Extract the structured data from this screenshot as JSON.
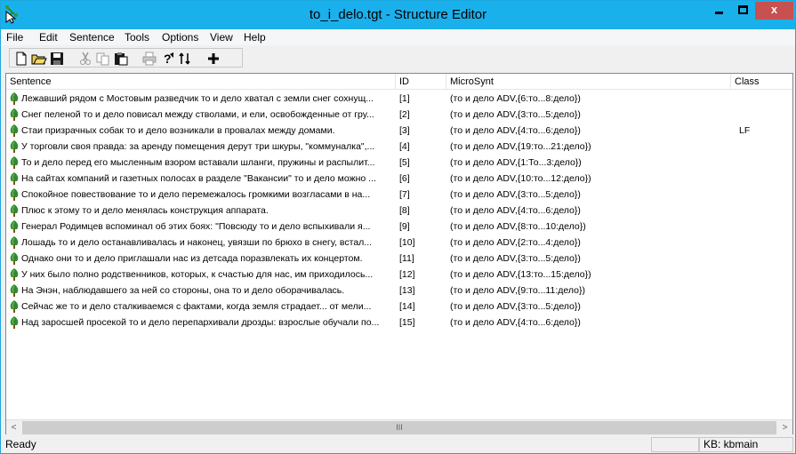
{
  "window": {
    "title": "to_i_delo.tgt - Structure Editor",
    "minimize_glyph": "",
    "close_glyph": "x"
  },
  "menu": [
    "File",
    "Edit",
    "Sentence",
    "Tools",
    "Options",
    "View",
    "Help"
  ],
  "toolbar": {
    "icons": [
      "new-document-icon",
      "open-folder-icon",
      "save-disk-icon",
      "cut-scissors-icon",
      "copy-icon",
      "paste-icon",
      "print-icon",
      "help-question-icon",
      "switch-icon",
      "add-plus-icon"
    ]
  },
  "table": {
    "columns": [
      "Sentence",
      "ID",
      "MicroSynt",
      "Class"
    ],
    "rows": [
      {
        "sentence": "Лежавший рядом с Мостовым разведчик то и дело хватал с земли снег сохнущ...",
        "id": "[1]",
        "microsynt": "(то и дело ADV,{6:то...8:дело})",
        "class": ""
      },
      {
        "sentence": "Снег пеленой то и дело повисал между стволами, и ели, освобожденные от гру...",
        "id": "[2]",
        "microsynt": "(то и дело ADV,{3:то...5:дело})",
        "class": ""
      },
      {
        "sentence": "Стаи призрачных собак то и дело возникали в провалах между домами.",
        "id": "[3]",
        "microsynt": "(то и дело ADV,{4:то...6:дело})",
        "class": "LF"
      },
      {
        "sentence": "У торговли своя правда: за аренду помещения дерут три шкуры, \"коммуналка\",...",
        "id": "[4]",
        "microsynt": "(то и дело ADV,{19:то...21:дело})",
        "class": ""
      },
      {
        "sentence": "То и дело перед его мысленным взором вставали шланги, пружины и распылит...",
        "id": "[5]",
        "microsynt": "(то и дело ADV,{1:То...3:дело})",
        "class": ""
      },
      {
        "sentence": "На сайтах компаний и газетных полосах в разделе \"Вакансии\" то и дело можно ...",
        "id": "[6]",
        "microsynt": "(то и дело ADV,{10:то...12:дело})",
        "class": ""
      },
      {
        "sentence": "Спокойное повествование то и дело перемежалось громкими возгласами в на...",
        "id": "[7]",
        "microsynt": "(то и дело ADV,{3:то...5:дело})",
        "class": ""
      },
      {
        "sentence": "Плюс к этому то и дело менялась конструкция аппарата.",
        "id": "[8]",
        "microsynt": "(то и дело ADV,{4:то...6:дело})",
        "class": ""
      },
      {
        "sentence": "Генерал Родимцев вспоминал об этих боях: \"Повсюду то и дело вспыхивали я...",
        "id": "[9]",
        "microsynt": "(то и дело ADV,{8:то...10:дело})",
        "class": ""
      },
      {
        "sentence": "Лошадь то и дело останавливалась и наконец, увязши по брюхо в снегу, встал...",
        "id": "[10]",
        "microsynt": "(то и дело ADV,{2:то...4:дело})",
        "class": ""
      },
      {
        "sentence": "Однако они то и дело приглашали нас из детсада поразвлекать их концертом.",
        "id": "[11]",
        "microsynt": "(то и дело ADV,{3:то...5:дело})",
        "class": ""
      },
      {
        "sentence": "У них было полно родственников, которых, к счастью для нас, им приходилось...",
        "id": "[12]",
        "microsynt": "(то и дело ADV,{13:то...15:дело})",
        "class": ""
      },
      {
        "sentence": "На Энэн, наблюдавшего за ней со стороны, она то и дело оборачивалась.",
        "id": "[13]",
        "microsynt": "(то и дело ADV,{9:то...11:дело})",
        "class": ""
      },
      {
        "sentence": "Сейчас же то и дело сталкиваемся с фактами, когда земля страдает... от мели...",
        "id": "[14]",
        "microsynt": "(то и дело ADV,{3:то...5:дело})",
        "class": ""
      },
      {
        "sentence": "Над заросшей просекой то и дело перепархивали дрозды: взрослые обучали по...",
        "id": "[15]",
        "microsynt": "(то и дело ADV,{4:то...6:дело})",
        "class": ""
      }
    ]
  },
  "scrollbar": {
    "left_arrow": "<",
    "right_arrow": ">",
    "thumb_grip": "III"
  },
  "status": {
    "left": "Ready",
    "kb": "KB: kbmain"
  }
}
